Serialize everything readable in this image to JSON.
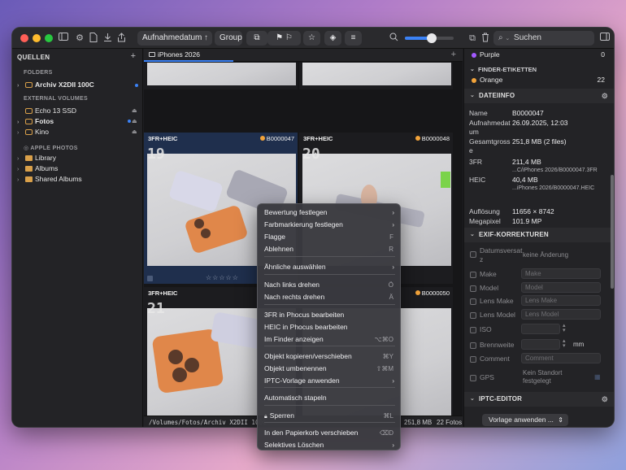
{
  "colors": {
    "accent": "#3b82f6",
    "label_orange": "#f2a33a",
    "label_purple": "#a259ff",
    "folder": "#d9a04a"
  },
  "toolbar": {
    "sort_label": "Aufnahmedatum",
    "group_label": "Group",
    "search_placeholder": "Suchen",
    "zoom_level": 0.55
  },
  "sidebar": {
    "title": "QUELLEN",
    "folders_header": "FOLDERS",
    "archive": "Archiv X2DII 100C",
    "external_header": "EXTERNAL VOLUMES",
    "volumes": [
      "Echo 13 SSD",
      "Fotos",
      "Kino"
    ],
    "apple_header": "APPLE PHOTOS",
    "apple_items": [
      "Library",
      "Albums",
      "Shared Albums"
    ]
  },
  "center": {
    "tab_label": "iPhones 2026",
    "cells": [
      {
        "format": "3FR+HEIC",
        "file": "B0000047",
        "number": "19"
      },
      {
        "format": "3FR+HEIC",
        "file": "B0000048",
        "number": "20"
      },
      {
        "format": "3FR+HEIC",
        "file": "",
        "number": "21"
      },
      {
        "format": "",
        "file": "B0000050",
        "number": ""
      }
    ],
    "stars": "☆☆☆☆☆",
    "status_path": "/Volumes/Fotos/Archiv X2DII 100C",
    "status_size": "251,8 MB",
    "status_count": "22 Fotos"
  },
  "panel": {
    "purple_label": "Purple",
    "purple_count": "0",
    "finder_header": "FINDER-ETIKETTEN",
    "orange_label": "Orange",
    "orange_count": "22",
    "fileinfo_header": "DATEIINFO",
    "name_lbl": "Name",
    "name_val": "B0000047",
    "date_lbl": "Aufnahmedat um",
    "date_val": "26.09.2025, 12:03",
    "total_lbl": "Gesamtgross e",
    "total_val": "251,8 MB (2 files)",
    "fr3_lbl": "3FR",
    "fr3_val": "211,4 MB",
    "fr3_path": "...C/iPhones 2026/B0000047.3FR",
    "heic_lbl": "HEIC",
    "heic_val": "40,4 MB",
    "heic_path": "...iPhones 2026/B0000047.HEIC",
    "res_lbl": "Auflösung",
    "res_val": "11656 × 8742",
    "mp_lbl": "Megapixel",
    "mp_val": "101.9 MP",
    "exif_header": "EXIF-KORREKTUREN",
    "offset_lbl": "Datumsversat z",
    "offset_val": "keine Änderung",
    "exif_fields": [
      {
        "label": "Make",
        "placeholder": "Make"
      },
      {
        "label": "Model",
        "placeholder": "Model"
      },
      {
        "label": "Lens Make",
        "placeholder": "Lens Make"
      },
      {
        "label": "Lens Model",
        "placeholder": "Lens Model"
      }
    ],
    "iso_lbl": "ISO",
    "focal_lbl": "Brennweite",
    "focal_unit": "mm",
    "comment_lbl": "Comment",
    "comment_ph": "Comment",
    "gps_lbl": "GPS",
    "gps_val": "Kein Standort festgelegt",
    "iptc_header": "IPTC-EDITOR",
    "iptc_btn": "Vorlage anwenden ..."
  },
  "menu": {
    "items": [
      {
        "label": "Bewertung festlegen",
        "shortcut": "",
        "arrow": "›"
      },
      {
        "label": "Farbmarkierung festlegen",
        "shortcut": "",
        "arrow": "›"
      },
      {
        "label": "Flagge",
        "shortcut": "F",
        "arrow": ""
      },
      {
        "label": "Ablehnen",
        "shortcut": "R",
        "arrow": ""
      },
      {
        "label": "Ähnliche auswählen",
        "shortcut": "",
        "arrow": "›"
      },
      {
        "label": "Nach links drehen",
        "shortcut": "Ö",
        "arrow": ""
      },
      {
        "label": "Nach rechts drehen",
        "shortcut": "Ä",
        "arrow": ""
      },
      {
        "label": "3FR in Phocus bearbeiten",
        "shortcut": "",
        "arrow": ""
      },
      {
        "label": "HEIC in Phocus bearbeiten",
        "shortcut": "",
        "arrow": ""
      },
      {
        "label": "Im Finder anzeigen",
        "shortcut": "⌥⌘O",
        "arrow": ""
      },
      {
        "label": "Objekt kopieren/verschieben",
        "shortcut": "⌘Y",
        "arrow": ""
      },
      {
        "label": "Objekt umbenennen",
        "shortcut": "⇧⌘M",
        "arrow": ""
      },
      {
        "label": "IPTC-Vorlage anwenden",
        "shortcut": "",
        "arrow": "›"
      },
      {
        "label": "Automatisch stapeln",
        "shortcut": "",
        "arrow": ""
      },
      {
        "label": "Sperren",
        "shortcut": "⌘L",
        "arrow": ""
      },
      {
        "label": "In den Papierkorb verschieben",
        "shortcut": "⌫D",
        "arrow": ""
      },
      {
        "label": "Selektives Löschen",
        "shortcut": "",
        "arrow": "›"
      }
    ]
  }
}
